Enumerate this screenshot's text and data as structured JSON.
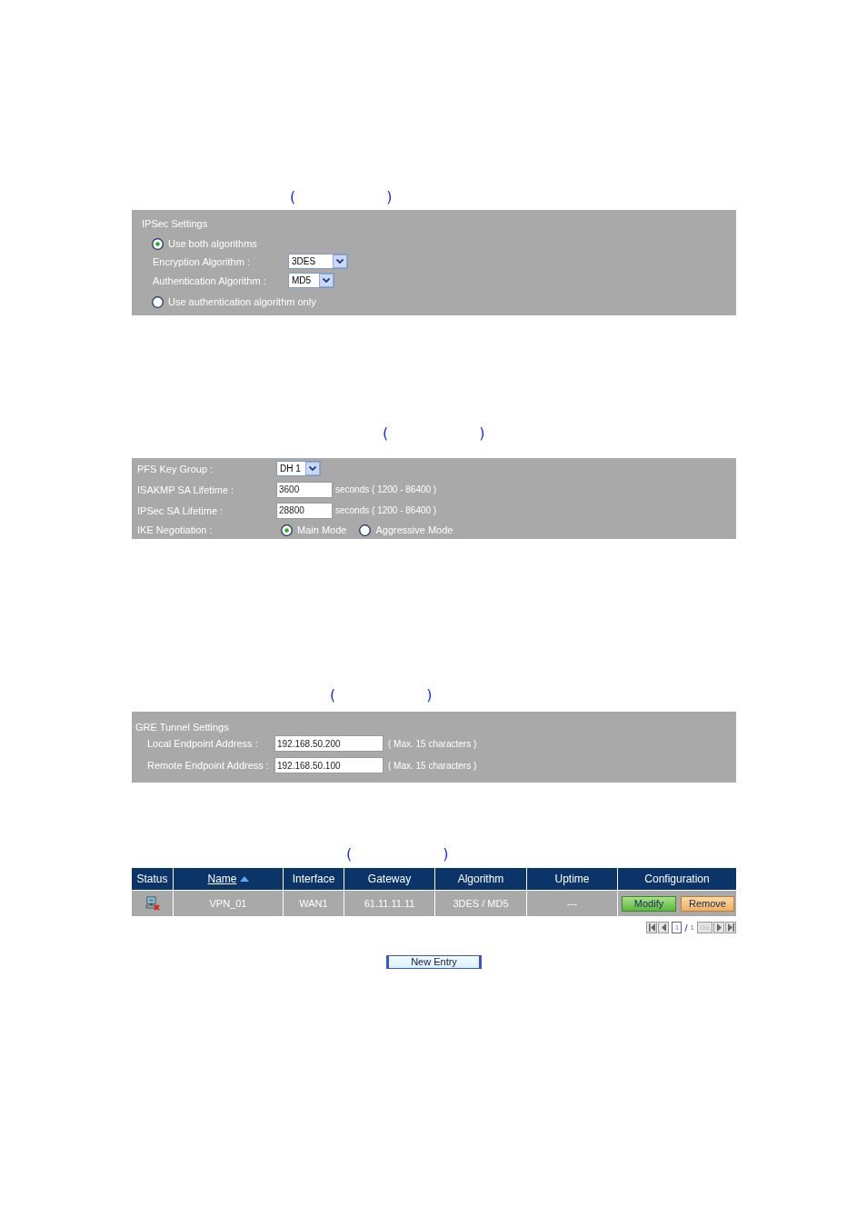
{
  "ipsec_section": {
    "caption": {
      "open": "(",
      "close": ")"
    },
    "title": "IPSec Settings",
    "options": [
      {
        "label": "Use both algorithms",
        "selected": true,
        "fields": [
          {
            "label": "Encryption Algorithm :",
            "value": "3DES"
          },
          {
            "label": "Authentication Algorithm :",
            "value": "MD5"
          }
        ]
      },
      {
        "label": "Use authentication algorithm only",
        "selected": false
      }
    ]
  },
  "pfs_section": {
    "caption": {
      "open": "(",
      "close": ")"
    },
    "rows": [
      {
        "kind": "select",
        "label": "PFS Key Group :",
        "value": "DH 1"
      },
      {
        "kind": "input",
        "label": "ISAKMP SA Lifetime :",
        "value": "3600",
        "hint": "seconds ( 1200 - 86400 )"
      },
      {
        "kind": "input",
        "label": "IPSec SA Lifetime :",
        "value": "28800",
        "hint": "seconds ( 1200 - 86400 )"
      },
      {
        "kind": "radio",
        "label": "IKE Negotiation :",
        "options": [
          {
            "label": "Main Mode",
            "selected": true
          },
          {
            "label": "Aggressive Mode",
            "selected": false
          }
        ]
      }
    ]
  },
  "gre_section": {
    "caption": {
      "open": "(",
      "close": ")"
    },
    "title": "GRE Tunnel Settings",
    "fields": [
      {
        "label": "Local Endpoint Address :",
        "value": "192.168.50.200",
        "hint": "( Max. 15 characters )"
      },
      {
        "label": "Remote Endpoint Address :",
        "value": "192.168.50.100",
        "hint": "( Max. 15 characters )"
      }
    ]
  },
  "tunnel_list": {
    "caption": {
      "open": "(",
      "close": ")"
    },
    "columns": [
      {
        "label": "Status",
        "sorted": false
      },
      {
        "label": "Name",
        "sorted": true
      },
      {
        "label": "Interface",
        "sorted": false
      },
      {
        "label": "Gateway",
        "sorted": false
      },
      {
        "label": "Algorithm",
        "sorted": false
      },
      {
        "label": "Uptime",
        "sorted": false
      },
      {
        "label": "Configuration",
        "sorted": false
      }
    ],
    "rows": [
      {
        "connected": false,
        "name": "VPN_01",
        "interface": "WAN1",
        "gateway": "61.11.11.11",
        "algorithm": "3DES / MD5",
        "uptime": "---",
        "actions": [
          {
            "kind": "modify",
            "label": "Modify"
          },
          {
            "kind": "remove",
            "label": "Remove"
          }
        ]
      }
    ],
    "pagination": {
      "page": "1",
      "separator": "/",
      "total": "1",
      "go": {
        "label": "Go",
        "disabled": true
      }
    }
  },
  "new_entry_button": {
    "label": "New Entry"
  }
}
